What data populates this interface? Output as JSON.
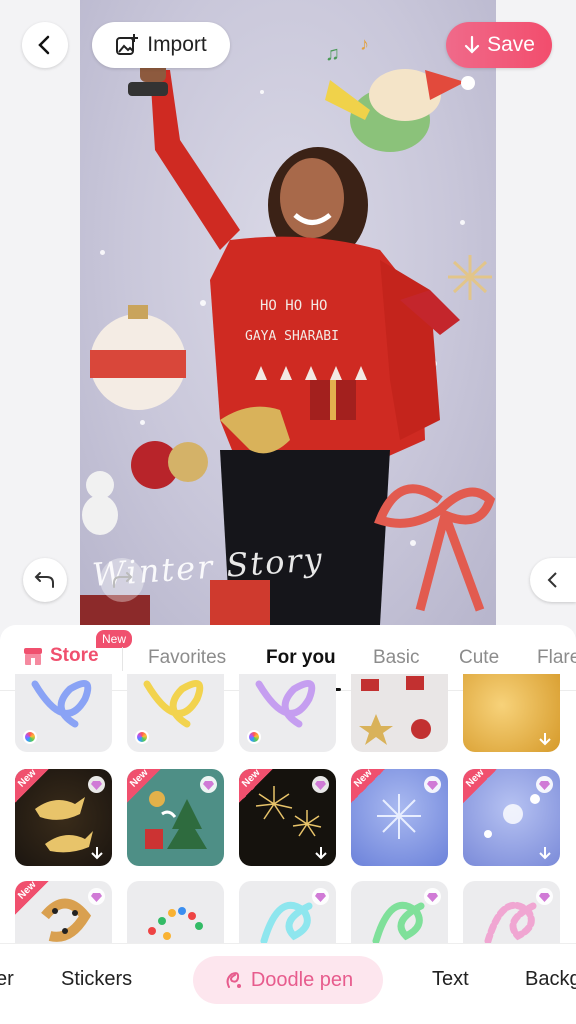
{
  "header": {
    "import_label": "Import",
    "save_label": "Save"
  },
  "canvas": {
    "overlay_text": "Winter Story",
    "sweater_text": [
      "HO HO HO",
      "GAYA SHARABI"
    ]
  },
  "panel": {
    "store_label": "Store",
    "new_badge": "New",
    "tabs": [
      "Favorites",
      "For you",
      "Basic",
      "Cute",
      "Flare"
    ],
    "active_tab": "For you"
  },
  "tiles": {
    "new_tag": "New"
  },
  "bottom_nav": {
    "items": [
      "er",
      "Stickers",
      "Doodle pen",
      "Text",
      "Backg"
    ],
    "active": "Doodle pen"
  },
  "colors": {
    "accent": "#f0506e",
    "save_gradient": [
      "#f06a8a",
      "#f24d6d"
    ],
    "doodle_pill_bg": "#fde6ee"
  },
  "icons": [
    "back-icon",
    "import-image-icon",
    "download-icon",
    "undo-icon",
    "redo-icon",
    "chevron-left-icon",
    "store-icon",
    "gem-icon",
    "doodle-pen-icon"
  ]
}
